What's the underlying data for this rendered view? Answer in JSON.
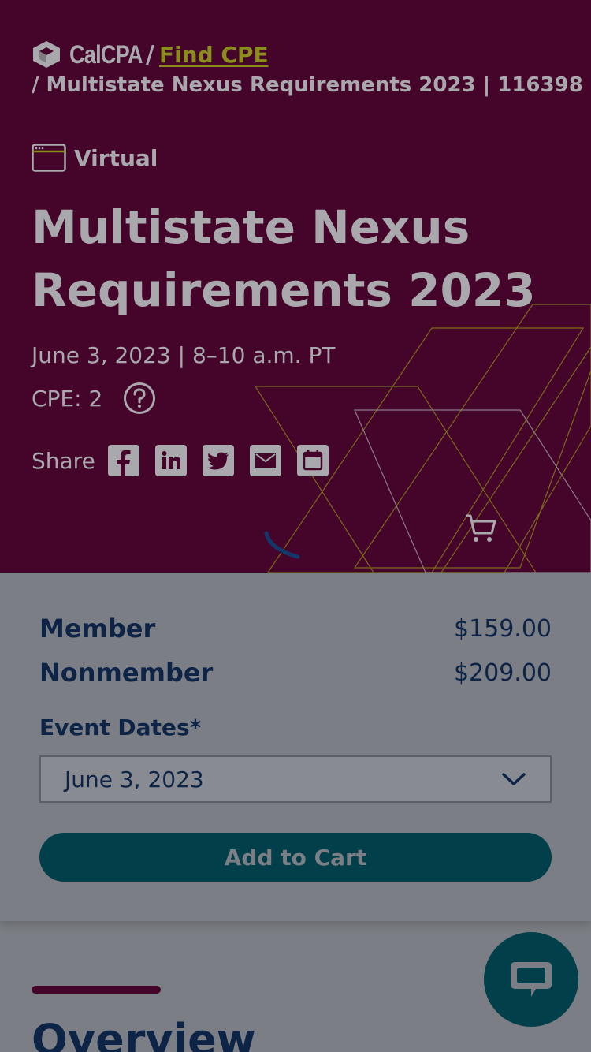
{
  "breadcrumb": {
    "logo_text": "CalCPA",
    "separator": "/",
    "link_label": "Find CPE",
    "current": "/ Multistate Nexus Requirements 2023 | 116398"
  },
  "event": {
    "format": "Virtual",
    "format_icon": "browser-window-icon",
    "title": "Multistate Nexus Requirements 2023",
    "date_time": "June 3, 2023 | 8–10 a.m. PT",
    "cpe": "CPE: 2",
    "help_icon": "question-circle-icon"
  },
  "share": {
    "label": "Share",
    "buttons": [
      "facebook-icon",
      "linkedin-icon",
      "twitter-icon",
      "email-icon",
      "calendar-icon"
    ]
  },
  "header": {
    "cart_icon": "cart-icon"
  },
  "pricing": {
    "member_label": "Member",
    "member_price": "$159.00",
    "nonmember_label": "Nonmember",
    "nonmember_price": "$209.00"
  },
  "event_dates": {
    "label": "Event Dates*",
    "selected": "June 3, 2023"
  },
  "add_to_cart_label": "Add to Cart",
  "overview": {
    "title": "Overview"
  },
  "chat": {
    "icon": "chat-bubble-icon"
  },
  "colors": {
    "hero_bg": "#45052b",
    "overlay_panel": "#7b7e84",
    "navy_text": "#0d2447",
    "teal_button": "#01404a",
    "link_olive": "#8a8c1e"
  }
}
